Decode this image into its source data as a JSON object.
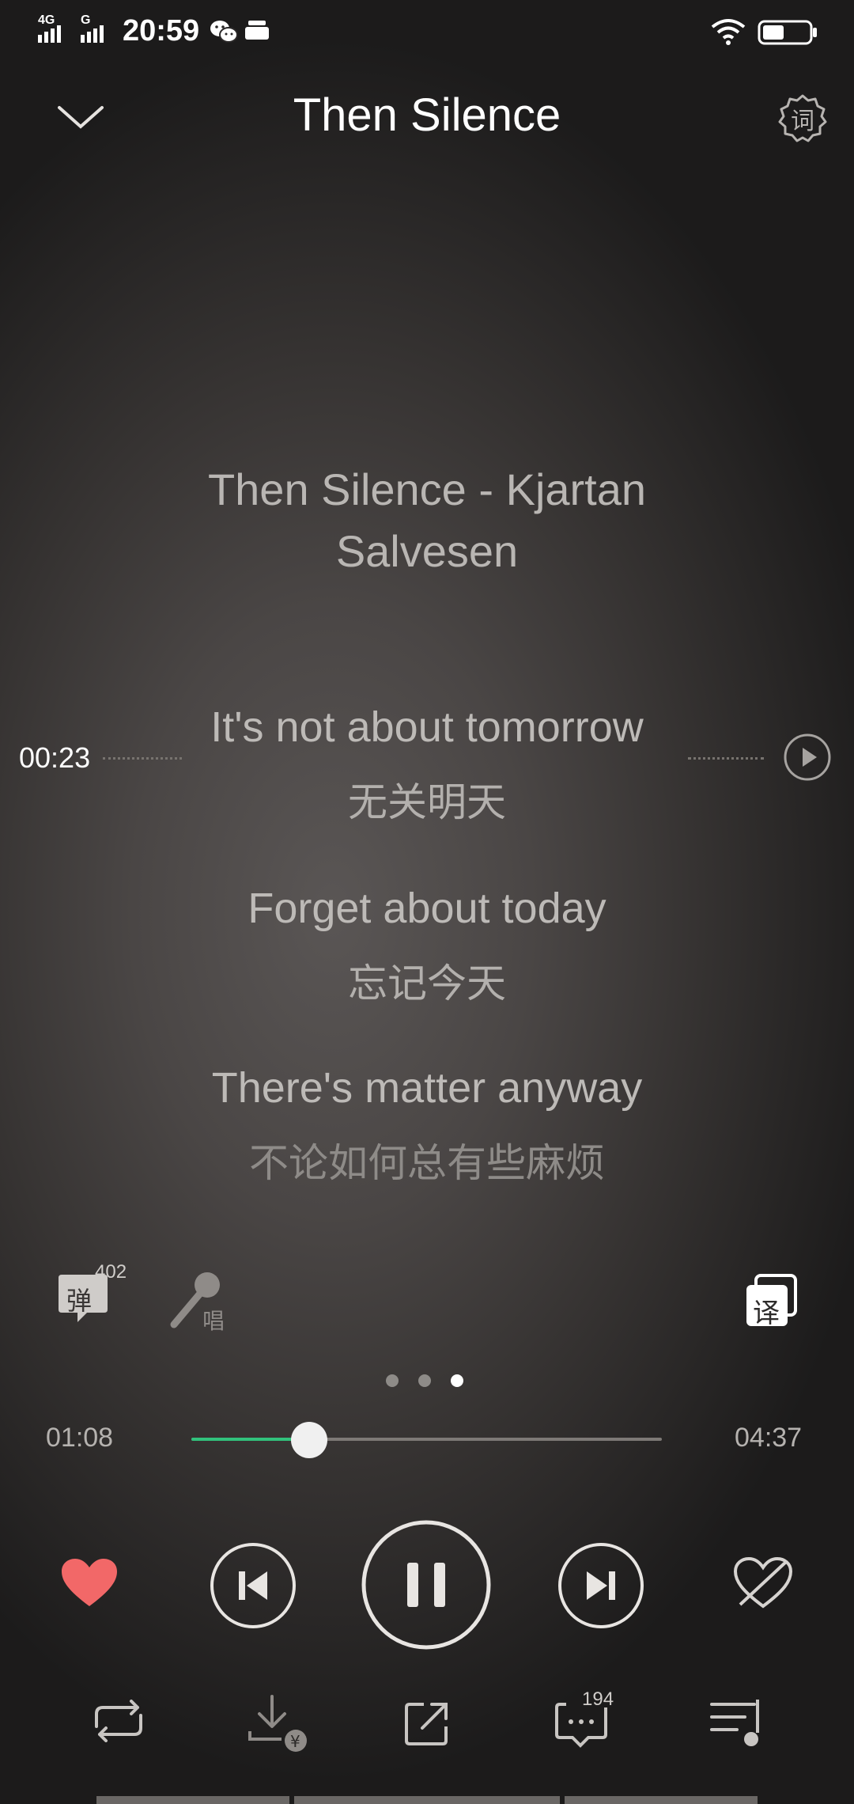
{
  "status_bar": {
    "network_label": "4G",
    "network_label_2": "G",
    "time": "20:59"
  },
  "header": {
    "title": "Then Silence",
    "lyric_settings_icon_text": "词"
  },
  "lyrics": {
    "heading": "Then Silence - Kjartan Salvesen",
    "current_time": "00:23",
    "lines": [
      {
        "en": "It's not about tomorrow",
        "cn": "无关明天"
      },
      {
        "en": "Forget about today",
        "cn": "忘记今天"
      },
      {
        "en": "There's matter anyway",
        "cn": "不论如何总有些麻烦"
      }
    ]
  },
  "tools": {
    "danmu_icon_text": "弹",
    "danmu_count": "402",
    "sing_icon_text": "唱",
    "translate_icon_text": "译"
  },
  "pager": {
    "count": 3,
    "active": 3
  },
  "progress": {
    "elapsed": "01:08",
    "total": "04:37",
    "fraction": 0.25
  },
  "colors": {
    "accent": "#31c27c",
    "like": "#f26868"
  },
  "bottom": {
    "comment_count": "194"
  }
}
